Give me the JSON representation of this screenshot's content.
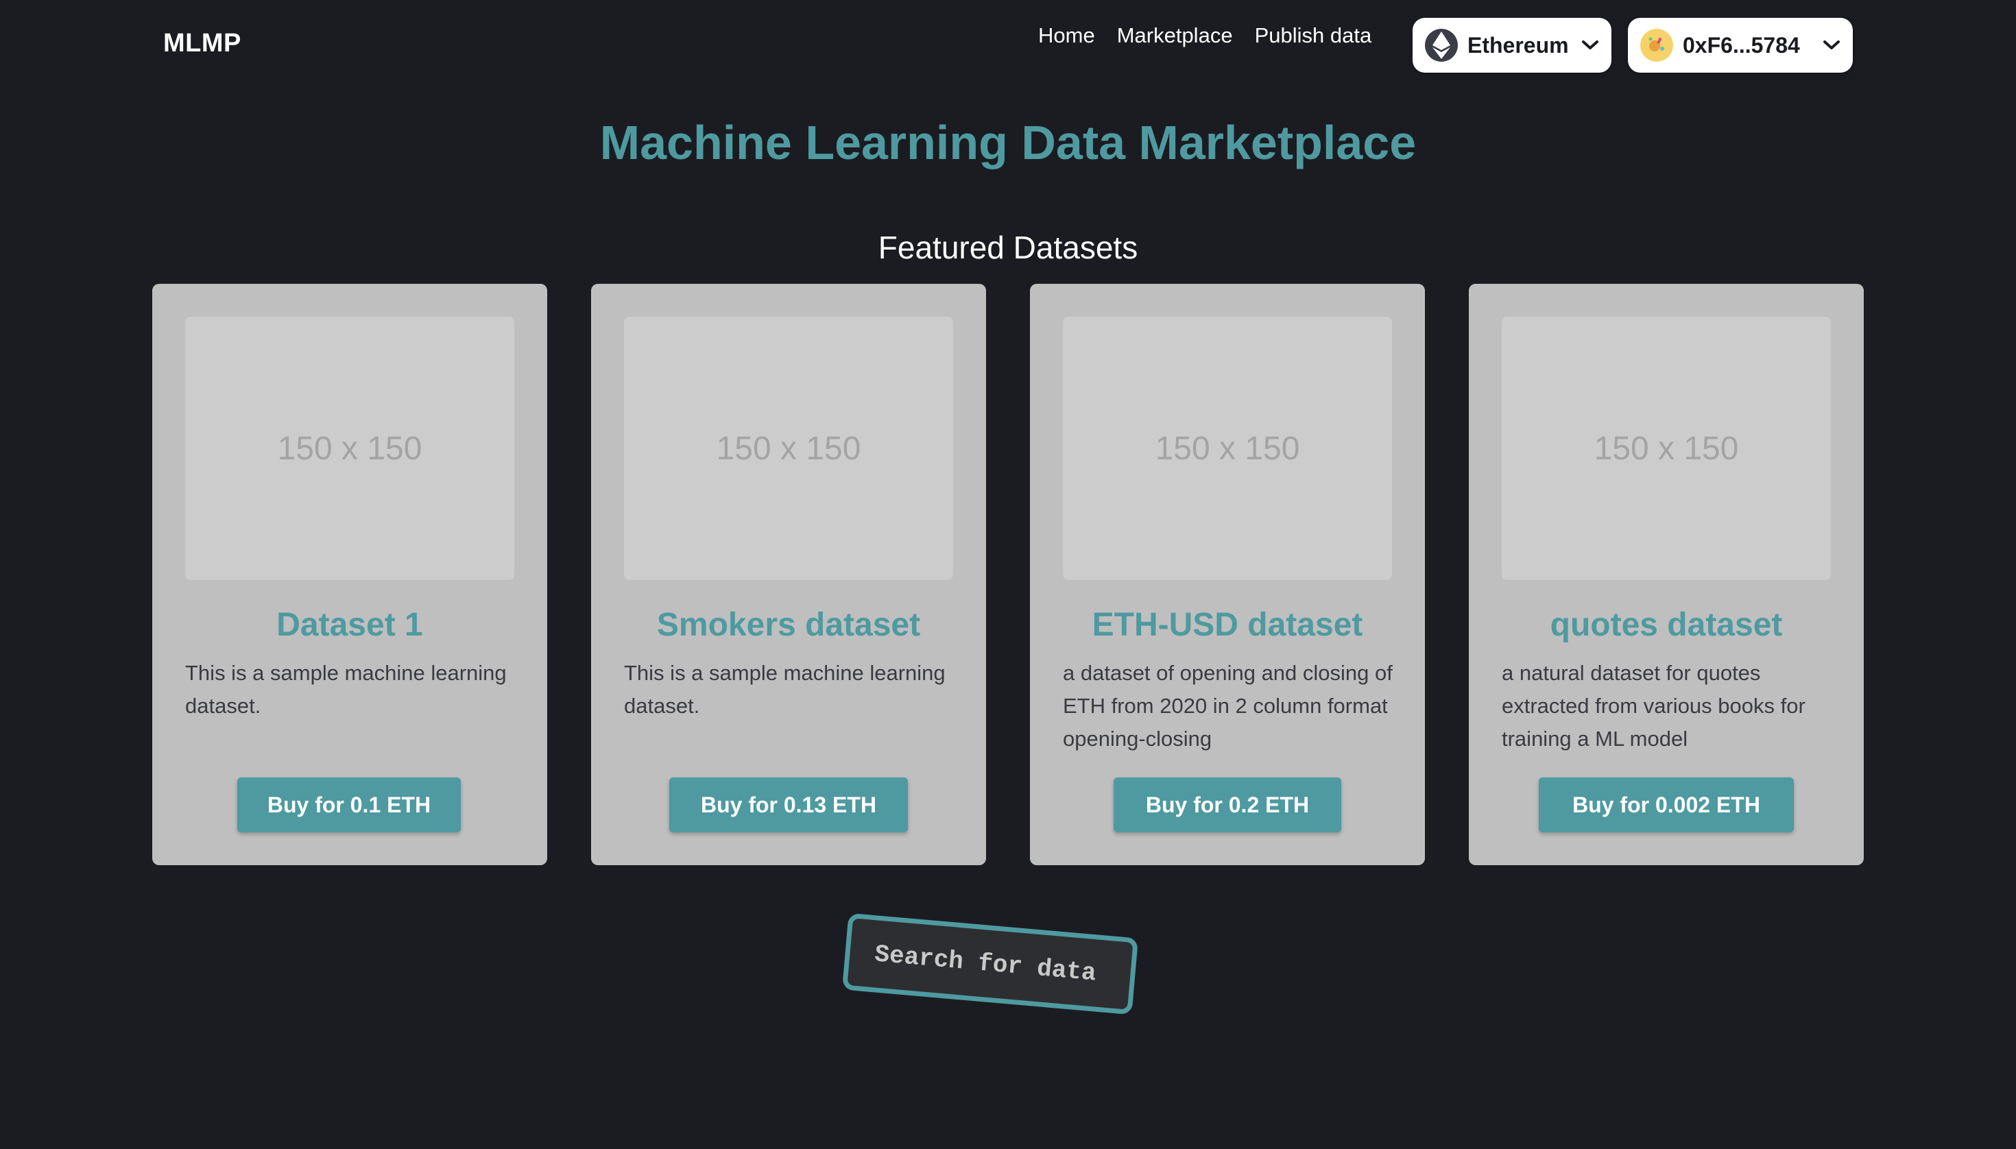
{
  "header": {
    "brand": "MLMP",
    "nav": {
      "home": "Home",
      "marketplace": "Marketplace",
      "publish": "Publish data"
    },
    "network": {
      "label": "Ethereum",
      "icon": "ethereum-icon"
    },
    "account": {
      "label": "0xF6...5784",
      "icon": "avatar-icon"
    }
  },
  "main": {
    "title": "Machine Learning Data Marketplace",
    "section_title": "Featured Datasets",
    "cards": [
      {
        "image_text": "150 x 150",
        "title": "Dataset 1",
        "description": "This is a sample machine learning dataset.",
        "button": "Buy for 0.1 ETH"
      },
      {
        "image_text": "150 x 150",
        "title": "Smokers dataset",
        "description": "This is a sample machine learning dataset.",
        "button": "Buy for 0.13 ETH"
      },
      {
        "image_text": "150 x 150",
        "title": "ETH-USD dataset",
        "description": "a dataset of opening and closing of ETH from 2020 in 2 column format opening-closing",
        "button": "Buy for 0.2 ETH"
      },
      {
        "image_text": "150 x 150",
        "title": "quotes dataset",
        "description": "a natural dataset for quotes extracted from various books for training a ML model",
        "button": "Buy for 0.002 ETH"
      }
    ]
  },
  "search": {
    "placeholder": "Search for data"
  },
  "colors": {
    "background": "#1b1c21",
    "accent": "#4e9aa0",
    "card": "#bfbfbf",
    "thumb": "#cccccc"
  }
}
